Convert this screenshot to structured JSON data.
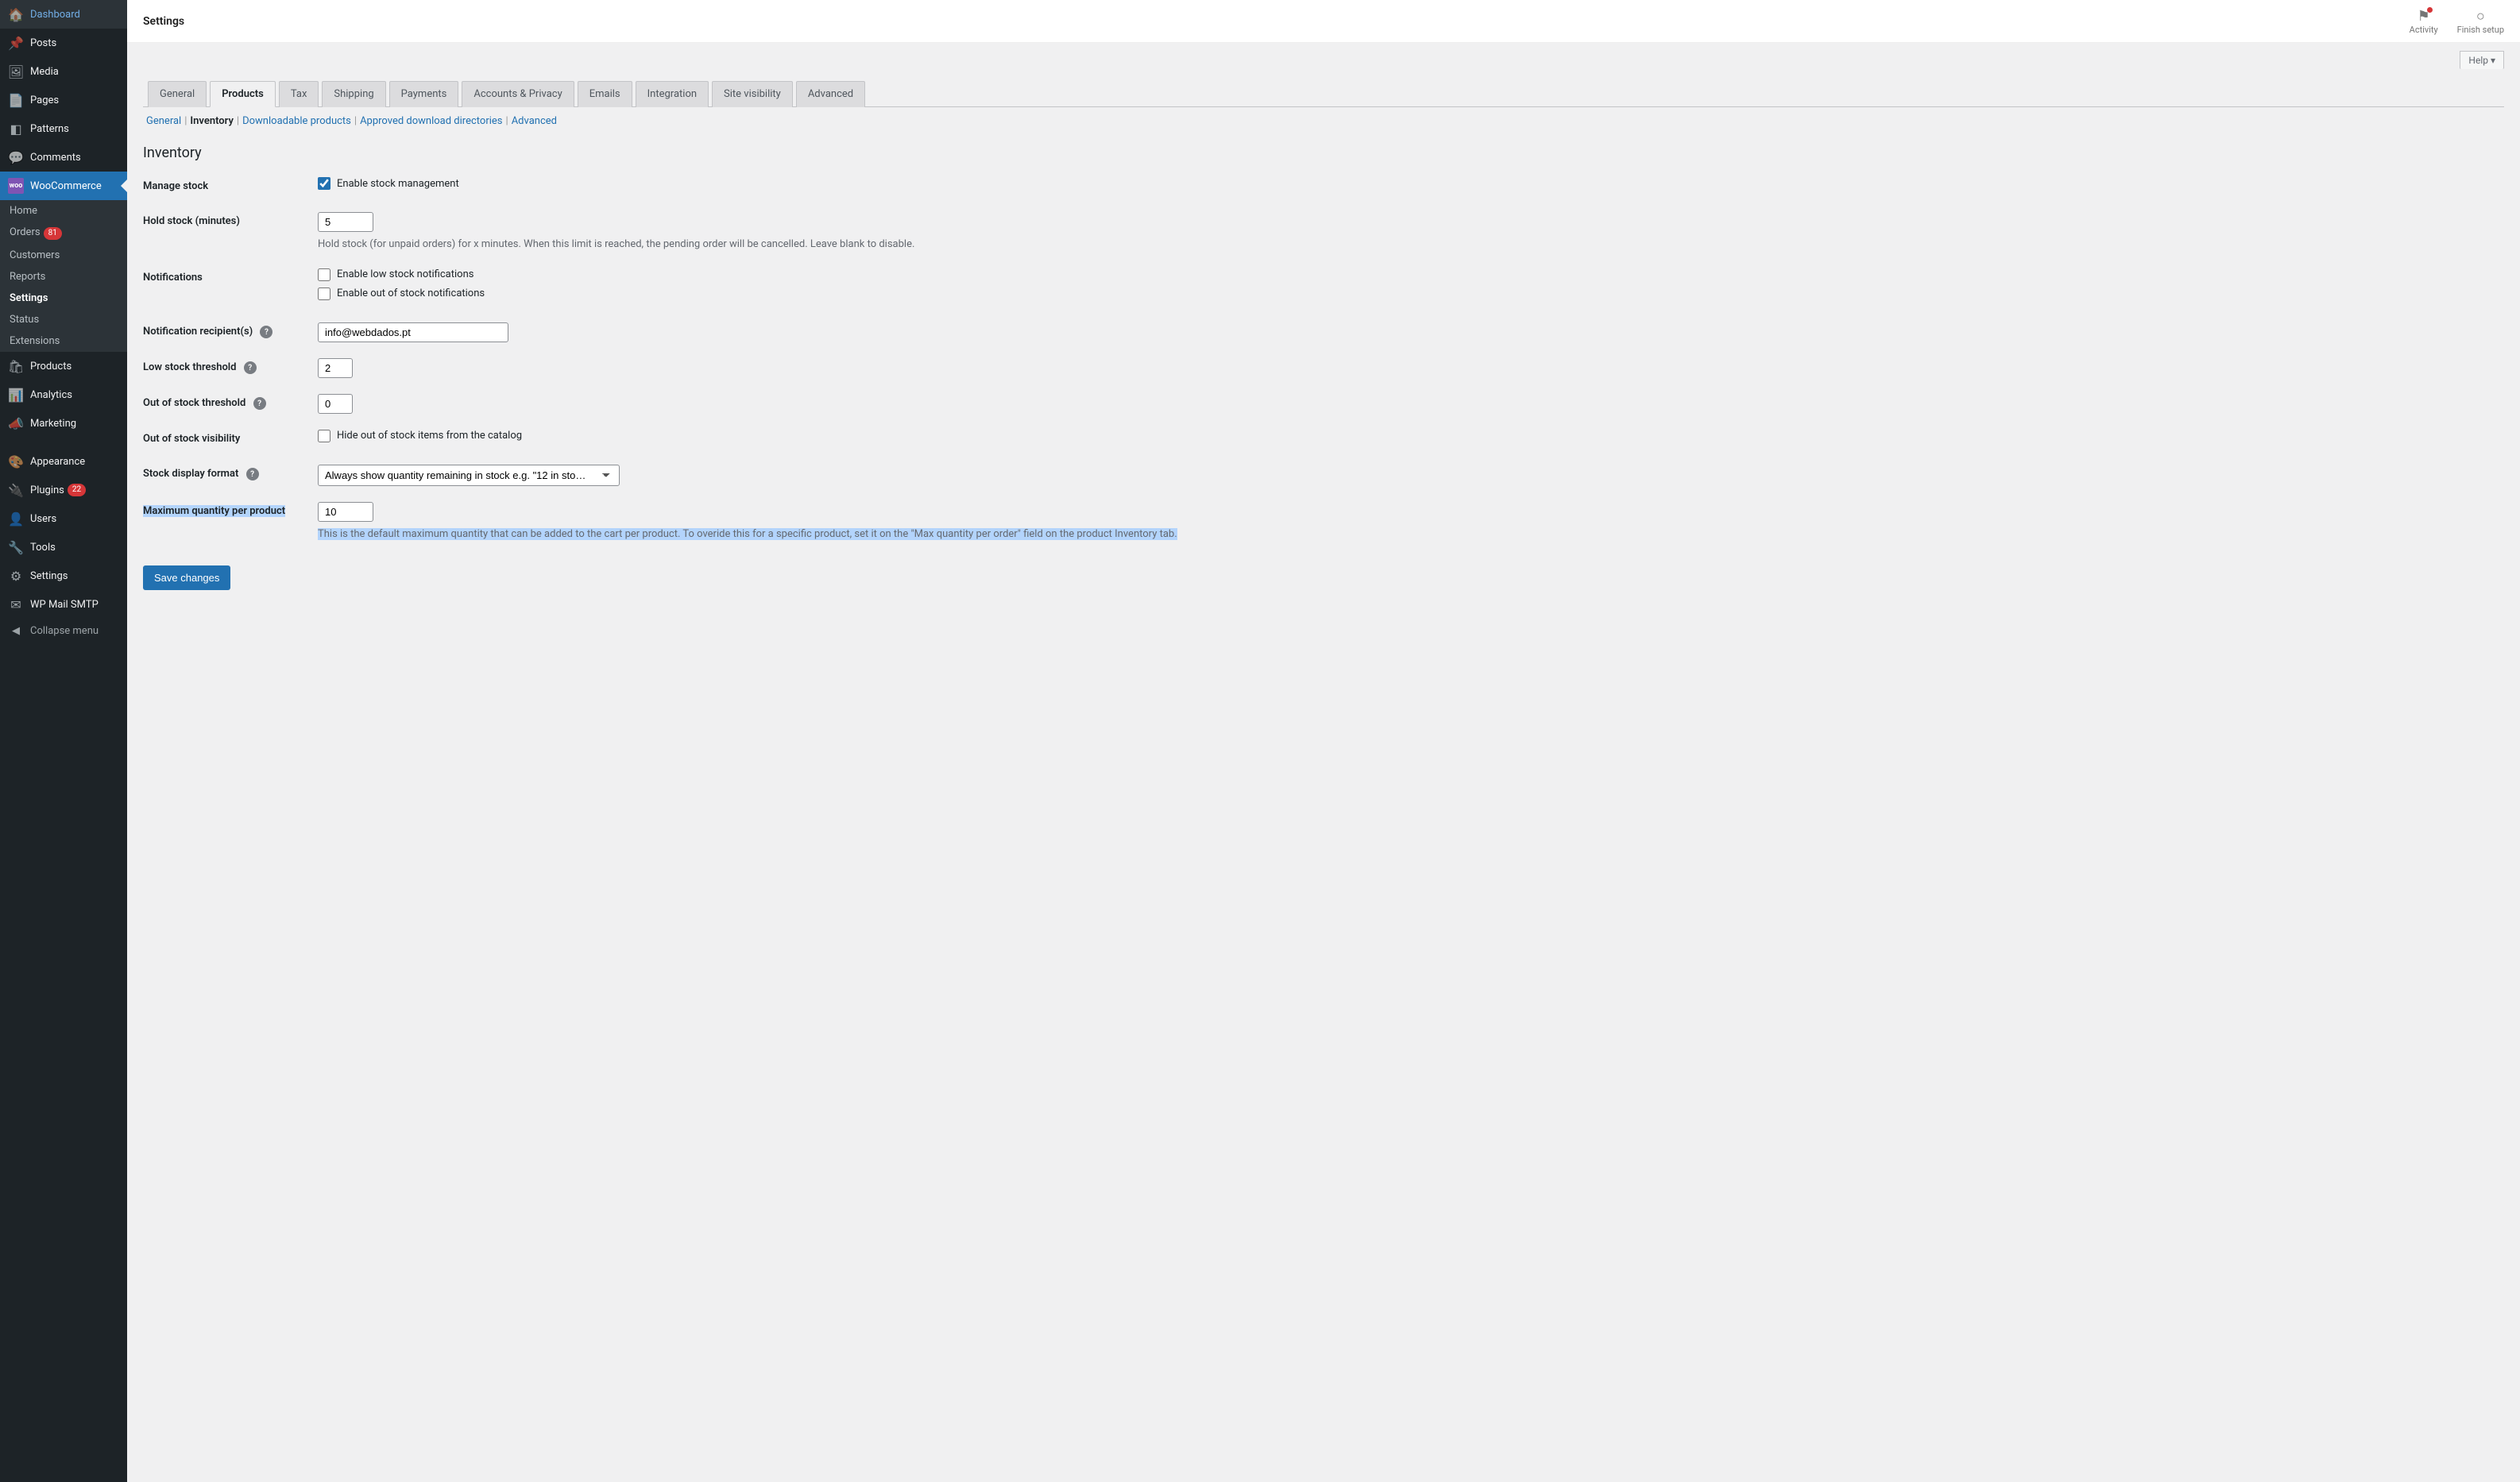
{
  "topbar": {
    "title": "Settings",
    "activity": "Activity",
    "finish_setup": "Finish setup",
    "help": "Help"
  },
  "sidebar": {
    "items": [
      {
        "icon": "🏠",
        "label": "Dashboard"
      },
      {
        "icon": "📌",
        "label": "Posts"
      },
      {
        "icon": "🖼",
        "label": "Media"
      },
      {
        "icon": "📄",
        "label": "Pages"
      },
      {
        "icon": "◧",
        "label": "Patterns"
      },
      {
        "icon": "💬",
        "label": "Comments"
      },
      {
        "icon": "woo",
        "label": "WooCommerce",
        "active": true
      },
      {
        "icon": "🛍",
        "label": "Products"
      },
      {
        "icon": "📊",
        "label": "Analytics"
      },
      {
        "icon": "📣",
        "label": "Marketing"
      },
      {
        "icon": "🎨",
        "label": "Appearance"
      },
      {
        "icon": "🔌",
        "label": "Plugins",
        "badge": "22"
      },
      {
        "icon": "👤",
        "label": "Users"
      },
      {
        "icon": "🔧",
        "label": "Tools"
      },
      {
        "icon": "⚙",
        "label": "Settings"
      },
      {
        "icon": "✉",
        "label": "WP Mail SMTP"
      }
    ],
    "woo_sub": [
      {
        "label": "Home"
      },
      {
        "label": "Orders",
        "badge": "81"
      },
      {
        "label": "Customers"
      },
      {
        "label": "Reports"
      },
      {
        "label": "Settings",
        "current": true
      },
      {
        "label": "Status"
      },
      {
        "label": "Extensions"
      }
    ],
    "collapse": "Collapse menu"
  },
  "tabs": [
    "General",
    "Products",
    "Tax",
    "Shipping",
    "Payments",
    "Accounts & Privacy",
    "Emails",
    "Integration",
    "Site visibility",
    "Advanced"
  ],
  "active_tab": "Products",
  "subsub": [
    {
      "label": "General"
    },
    {
      "label": "Inventory",
      "current": true
    },
    {
      "label": "Downloadable products"
    },
    {
      "label": "Approved download directories"
    },
    {
      "label": "Advanced"
    }
  ],
  "section_title": "Inventory",
  "form": {
    "manage_stock": {
      "label": "Manage stock",
      "checkbox": "Enable stock management",
      "checked": true
    },
    "hold_stock": {
      "label": "Hold stock (minutes)",
      "value": "5",
      "desc": "Hold stock (for unpaid orders) for x minutes. When this limit is reached, the pending order will be cancelled. Leave blank to disable."
    },
    "notifications": {
      "label": "Notifications",
      "low": "Enable low stock notifications",
      "out": "Enable out of stock notifications"
    },
    "recipients": {
      "label": "Notification recipient(s)",
      "value": "info@webdados.pt"
    },
    "low_threshold": {
      "label": "Low stock threshold",
      "value": "2"
    },
    "out_threshold": {
      "label": "Out of stock threshold",
      "value": "0"
    },
    "out_visibility": {
      "label": "Out of stock visibility",
      "checkbox": "Hide out of stock items from the catalog"
    },
    "stock_display": {
      "label": "Stock display format",
      "value": "Always show quantity remaining in stock e.g. \"12 in sto…"
    },
    "max_qty": {
      "label": "Maximum quantity per product",
      "value": "10",
      "desc": "This is the default maximum quantity that can be added to the cart per product. To overide this for a specific product, set it on the \"Max quantity per order\" field on the product Inventory tab."
    }
  },
  "save": "Save changes"
}
